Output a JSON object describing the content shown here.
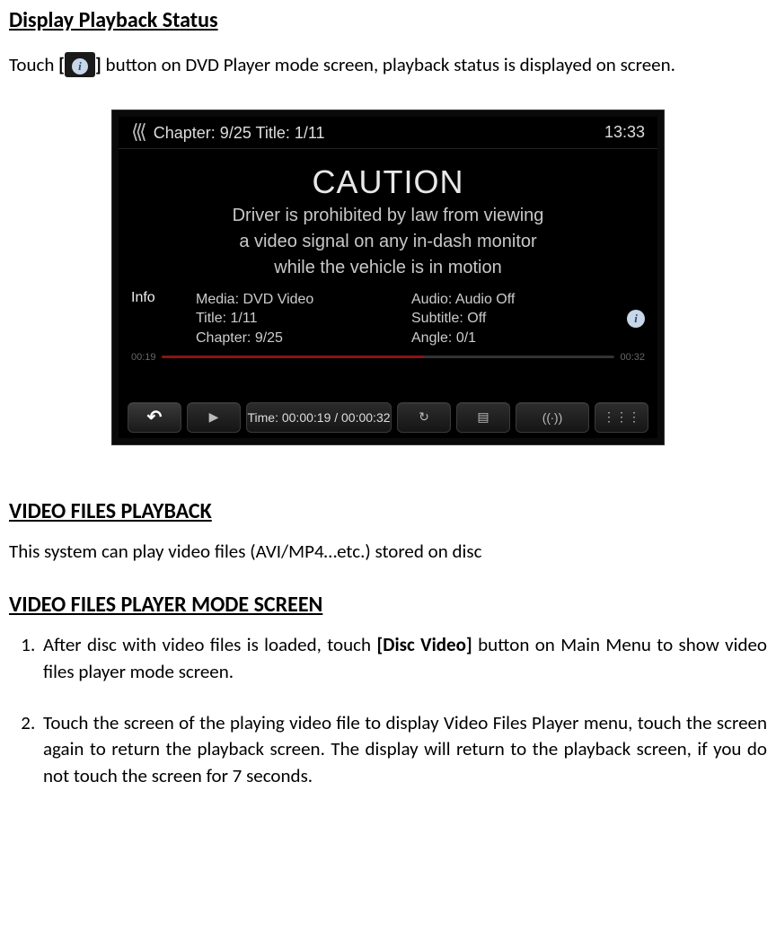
{
  "section1": {
    "heading": "Display Playback Status",
    "p_pre": "Touch ",
    "p_bracket_open": "[",
    "p_bracket_close": "]",
    "p_post": " button on DVD Player mode screen, playback status is displayed on screen."
  },
  "shot": {
    "top_chapter": "Chapter: 9/25 Title: 1/11",
    "clock": "13:33",
    "caution_title": "CAUTION",
    "caution_line1": "Driver is prohibited by law from viewing",
    "caution_line2": "a video signal on any in-dash monitor",
    "caution_line3": "while the vehicle is in motion",
    "info_label": "Info",
    "media": "Media: DVD Video",
    "title": "Title: 1/11",
    "chapter": "Chapter: 9/25",
    "audio": "Audio: Audio Off",
    "subtitle": "Subtitle: Off",
    "angle": "Angle: 0/1",
    "prog_left": "00:19",
    "prog_right": "00:32",
    "time_line": "Time: 00:00:19 / 00:00:32"
  },
  "section2": {
    "heading": "VIDEO FILES PLAYBACK",
    "body": "This system can play video files (AVI/MP4…etc.) stored on disc"
  },
  "section3": {
    "heading": "VIDEO FILES PLAYER MODE SCREEN",
    "step1_pre": "After disc with video files is loaded, touch ",
    "step1_bold": "[Disc Video]",
    "step1_post": " button on Main Menu to show video files player mode screen.",
    "step2": "Touch the screen of the playing video file to display Video Files Player menu, touch the screen again to return the playback screen. The display will return to the playback screen, if you do not touch the screen for 7 seconds."
  }
}
